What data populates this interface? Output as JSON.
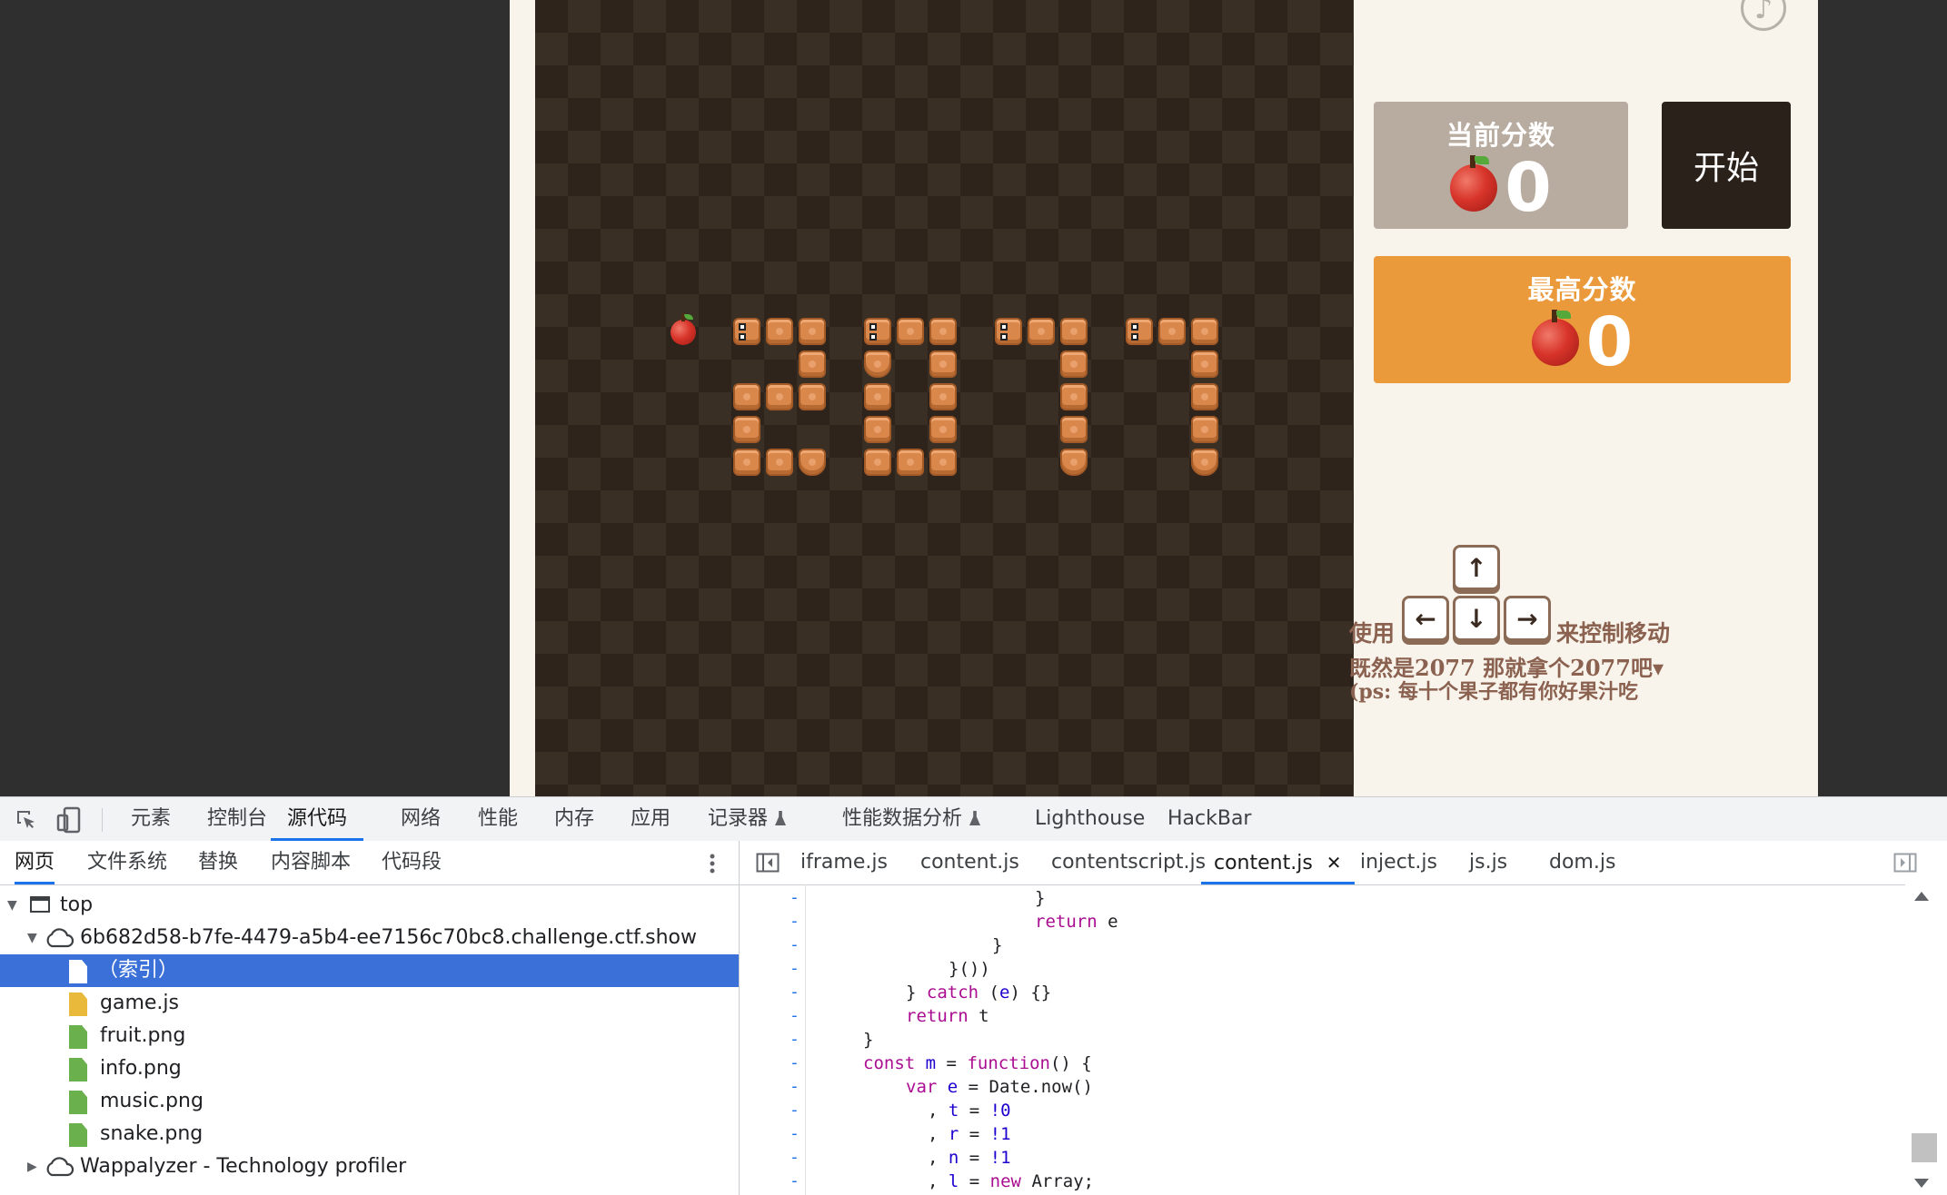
{
  "game": {
    "current_score_title": "当前分数",
    "current_score": "0",
    "high_score_title": "最高分数",
    "high_score": "0",
    "start_label": "开始",
    "music_icon": "♪",
    "keys": {
      "up": "↑",
      "left": "←",
      "down": "↓",
      "right": "→"
    },
    "hint_use": "使用",
    "hint_move": "来控制移动",
    "hint_line2": "既然是2077 那就拿个2077吧▾",
    "hint_line3": "(ps: 每十个果子都有你好果汁吃",
    "colors": {
      "current_box": "#b8aca1",
      "high_box": "#eb9a3b",
      "start_button": "#2b211b",
      "board": "#2e241b"
    }
  },
  "devtools": {
    "main_tabs": [
      "元素",
      "控制台",
      "源代码",
      "网络",
      "性能",
      "内存",
      "应用",
      "记录器",
      "性能数据分析",
      "Lighthouse",
      "HackBar"
    ],
    "active_main_tab": "源代码",
    "nav_tabs": [
      "网页",
      "文件系统",
      "替换",
      "内容脚本",
      "代码段"
    ],
    "active_nav_tab": "网页",
    "tree": {
      "top": "top",
      "domain": "6b682d58-b7fe-4479-a5b4-ee7156c70bc8.challenge.ctf.show",
      "files": [
        "（索引）",
        "game.js",
        "fruit.png",
        "info.png",
        "music.png",
        "snake.png"
      ],
      "selected_file": "（索引）",
      "extension": "Wappalyzer - Technology profiler"
    },
    "editor_tabs": [
      "iframe.js",
      "content.js",
      "contentscript.js",
      "content.js",
      "inject.js",
      "js.js",
      "dom.js"
    ],
    "active_editor_tab": "content.js",
    "gutter_marker": "-",
    "code_lines": [
      "}",
      "return e",
      "}",
      "}())",
      "} catch (e) {}",
      "return t",
      "}",
      "const m = function() {",
      "var e = Date.now()",
      ", t = !0",
      ", r = !1",
      ", n = !1",
      ", l = new Array;"
    ]
  }
}
